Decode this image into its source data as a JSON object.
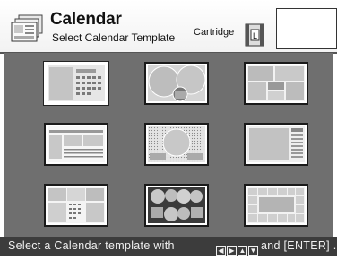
{
  "header": {
    "title": "Calendar",
    "subtitle": "Select Calendar Template",
    "cartridge_label": "Cartridge",
    "cartridge_icon_letter": "L"
  },
  "templates": {
    "count": 9,
    "columns": 3,
    "rows": 3,
    "selected_index": 0,
    "items": [
      {
        "name": "template-1"
      },
      {
        "name": "template-2"
      },
      {
        "name": "template-3"
      },
      {
        "name": "template-4"
      },
      {
        "name": "template-5"
      },
      {
        "name": "template-6"
      },
      {
        "name": "template-7"
      },
      {
        "name": "template-8"
      },
      {
        "name": "template-9"
      }
    ]
  },
  "footer": {
    "prefix": "Select a Calendar template with",
    "arrow_left": "◀",
    "arrow_right": "▶",
    "arrow_up": "▲",
    "arrow_down": "▼",
    "suffix": "and [ENTER] ."
  },
  "colors": {
    "grid_bg": "#6f6f6f",
    "footer_bg": "#3c3c3c",
    "thumb_fill": "#cfcfcf",
    "thumb_dark": "#9a9a9a"
  }
}
